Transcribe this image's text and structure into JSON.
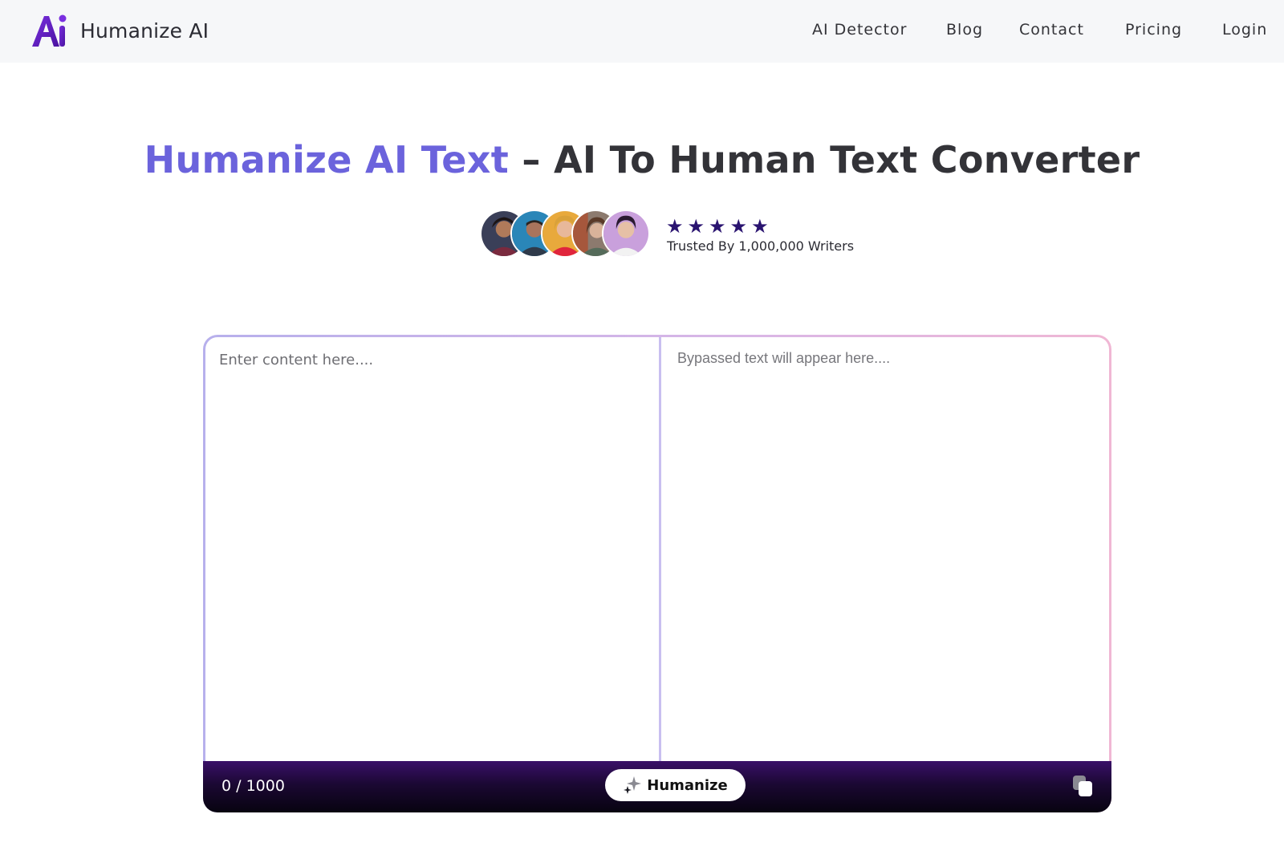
{
  "brand": {
    "name": "Humanize AI",
    "logo": "ai-logo-mark"
  },
  "nav": [
    {
      "label": "AI Detector"
    },
    {
      "label": "Blog"
    },
    {
      "label": "Contact"
    },
    {
      "label": "Pricing"
    },
    {
      "label": "Login"
    }
  ],
  "hero": {
    "title_accent": "Humanize AI Text",
    "title_rest": " – AI To Human Text Converter"
  },
  "rating": {
    "stars": 5,
    "trusted_text": "Trusted By 1,000,000 Writers"
  },
  "editor": {
    "input_placeholder": "Enter content here....",
    "output_placeholder": "Bypassed text will appear here....",
    "char_count": "0 / 1000",
    "humanize_label": "Humanize",
    "copy_icon": "copy-icon"
  },
  "colors": {
    "accent": "#6b63dc",
    "logo_purple": "#5a1fb3",
    "star": "#2a1470",
    "toolbar_dark": "#070310"
  }
}
